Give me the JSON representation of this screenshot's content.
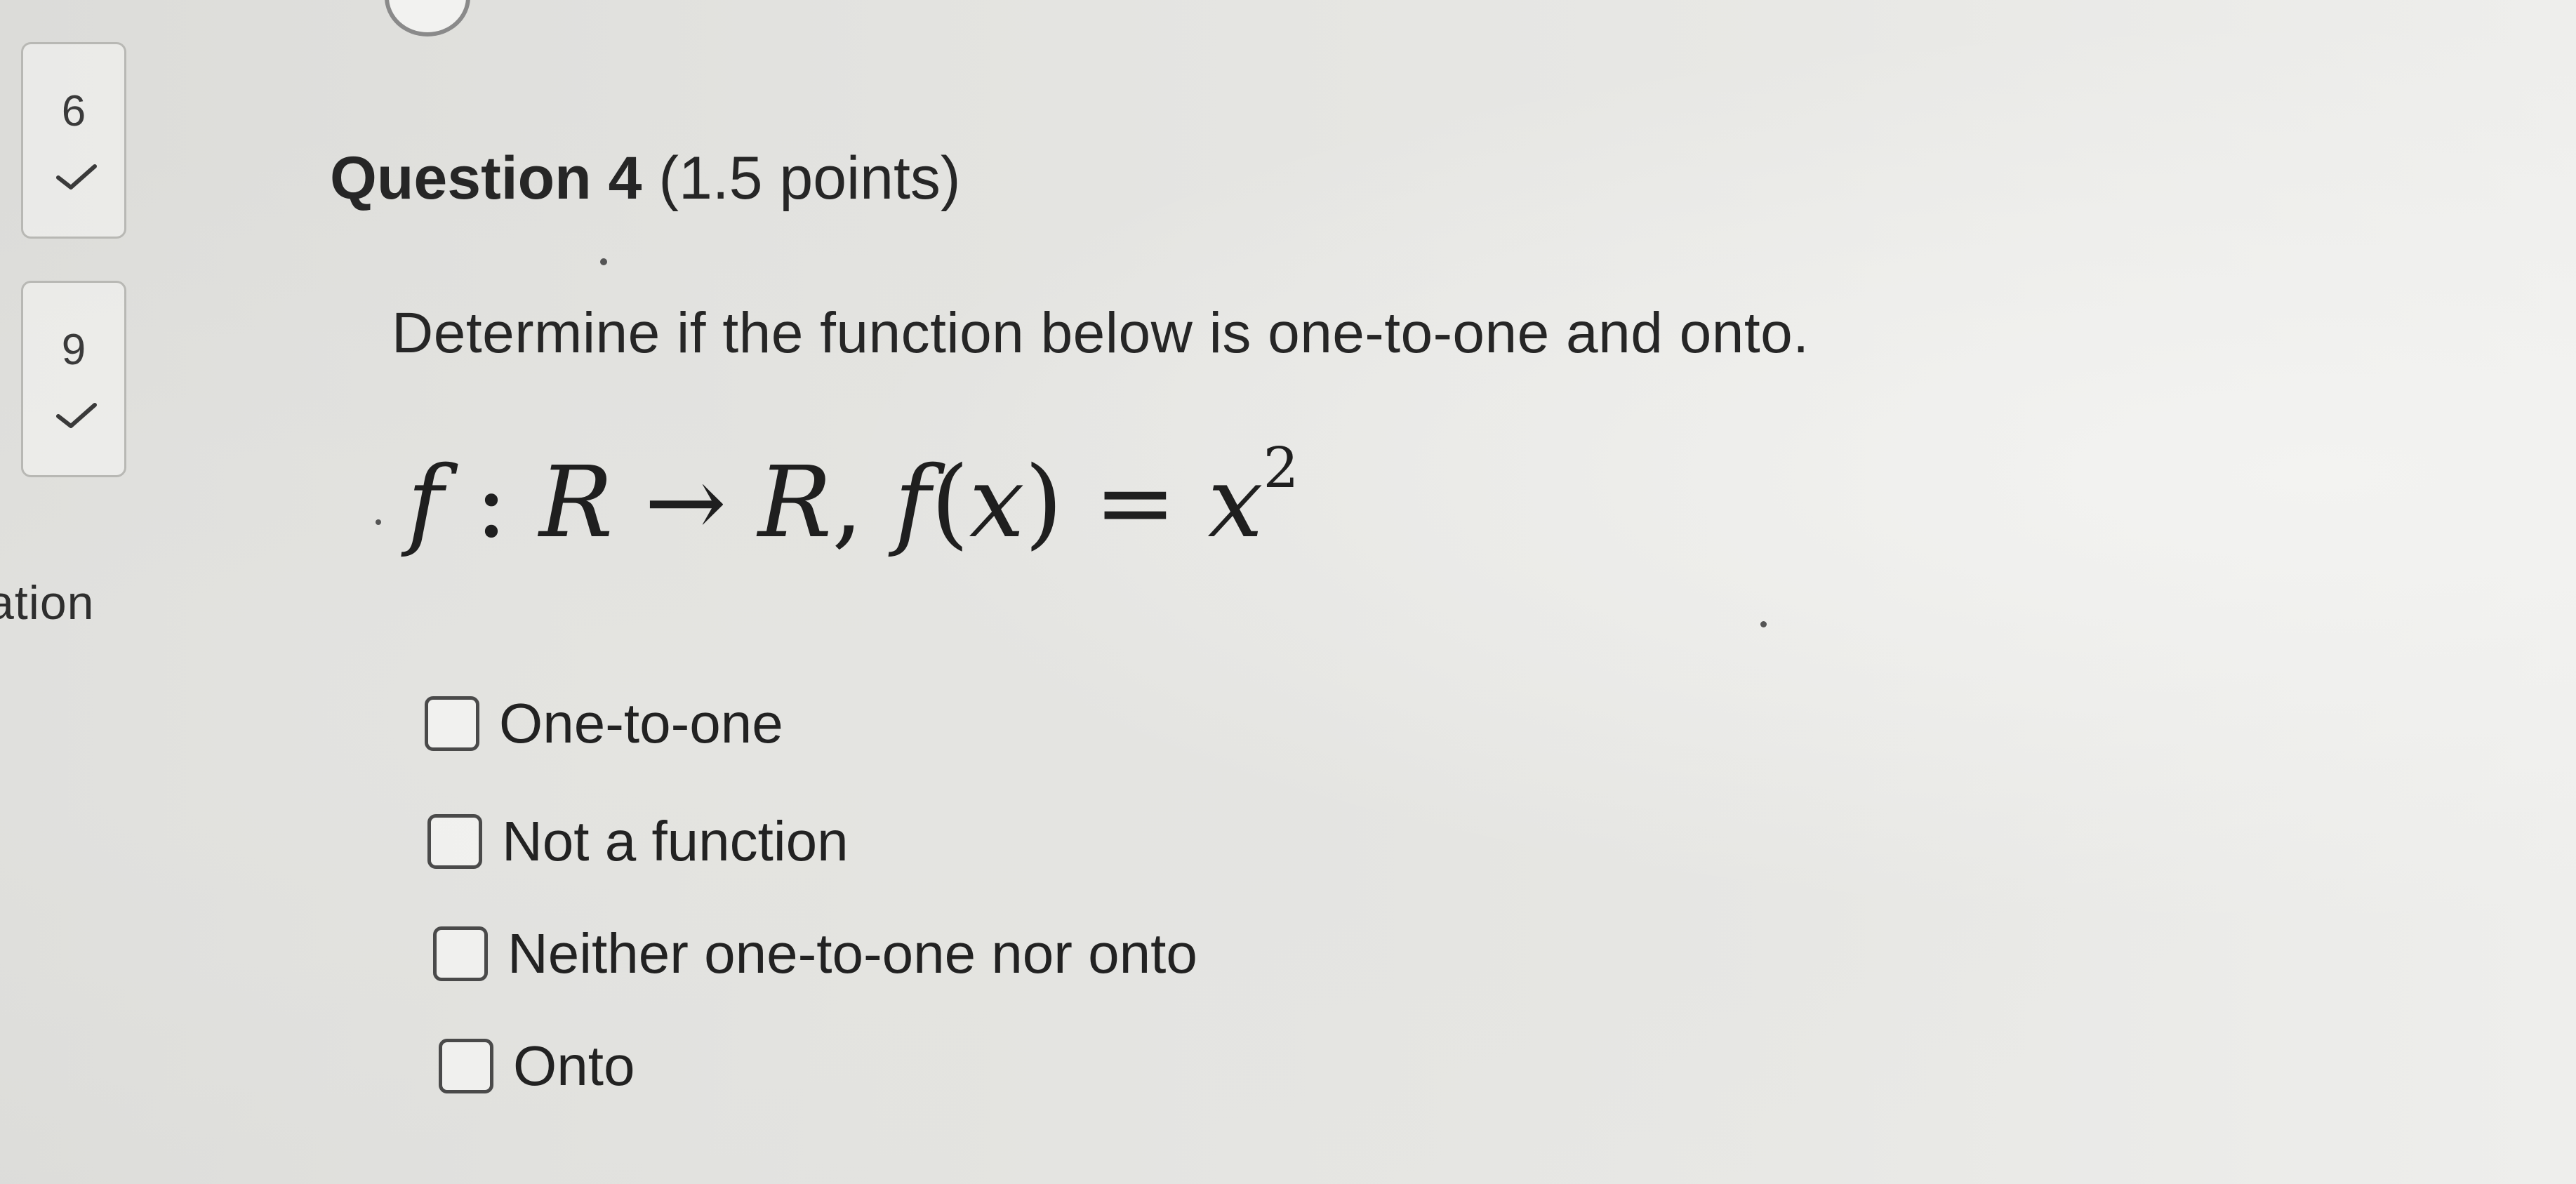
{
  "navigator": {
    "items": [
      {
        "number": "6",
        "status_icon": "checkmark-icon"
      },
      {
        "number": "9",
        "status_icon": "checkmark-icon"
      }
    ],
    "partial_label": "ation"
  },
  "question": {
    "title": "Question 4",
    "points": "(1.5 points)",
    "prompt": "Determine if the function below is one-to-one and onto.",
    "math": {
      "f1": "f",
      "colon": " : ",
      "domain": "R",
      "arrow": " → ",
      "codomain": "R",
      "comma": ", ",
      "f2": "f",
      "lparen": "(",
      "var": "x",
      "rparen": ")",
      "equals": " = ",
      "rhs_var": "x",
      "exponent": "2"
    },
    "options": [
      {
        "label": "One-to-one",
        "checked": false
      },
      {
        "label": "Not a function",
        "checked": false
      },
      {
        "label": "Neither one-to-one nor onto",
        "checked": false
      },
      {
        "label": "Onto",
        "checked": false
      }
    ]
  },
  "colors": {
    "text": "#262626",
    "border": "#4a4a4a",
    "card_border": "#b8b8b4"
  }
}
